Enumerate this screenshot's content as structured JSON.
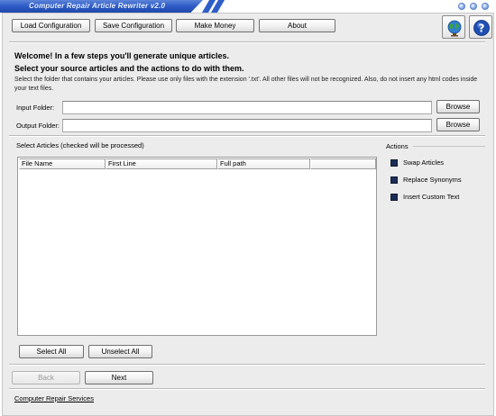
{
  "window": {
    "title": "Computer Repair Article Rewriter v2.0"
  },
  "toolbar": {
    "load_label": "Load Configuration",
    "save_label": "Save Configuration",
    "money_label": "Make Money",
    "about_label": "About"
  },
  "icons": {
    "globe": "globe-icon",
    "help": "help-icon"
  },
  "intro": {
    "line1": "Welcome! In a few steps you'll generate unique articles.",
    "line2": "Select your source articles and the actions to do with them.",
    "description": "Select the folder that contains your articles. Please use only files with the extension '.txt'. All other files will not be recognized. Also, do not insert any html codes inside your text files."
  },
  "folders": {
    "input_label": "Input Folder:",
    "input_value": "",
    "output_label": "Output Folder:",
    "output_value": "",
    "browse_label": "Browse"
  },
  "articles": {
    "section_label": "Select Articles (checked will be processed)",
    "columns": [
      "File Name",
      "First Line",
      "Full path",
      ""
    ],
    "select_all_label": "Select All",
    "unselect_all_label": "Unselect All"
  },
  "actions": {
    "title": "Actions",
    "items": [
      "Swap Articles",
      "Replace Synonyms",
      "Insert Custom Text"
    ]
  },
  "nav": {
    "back_label": "Back",
    "next_label": "Next"
  },
  "footer": {
    "link_label": "Computer Repair Services"
  },
  "colors": {
    "titlebar": "#2f5ec8",
    "panel": "#ececec",
    "checkbox": "#1c2d55"
  }
}
